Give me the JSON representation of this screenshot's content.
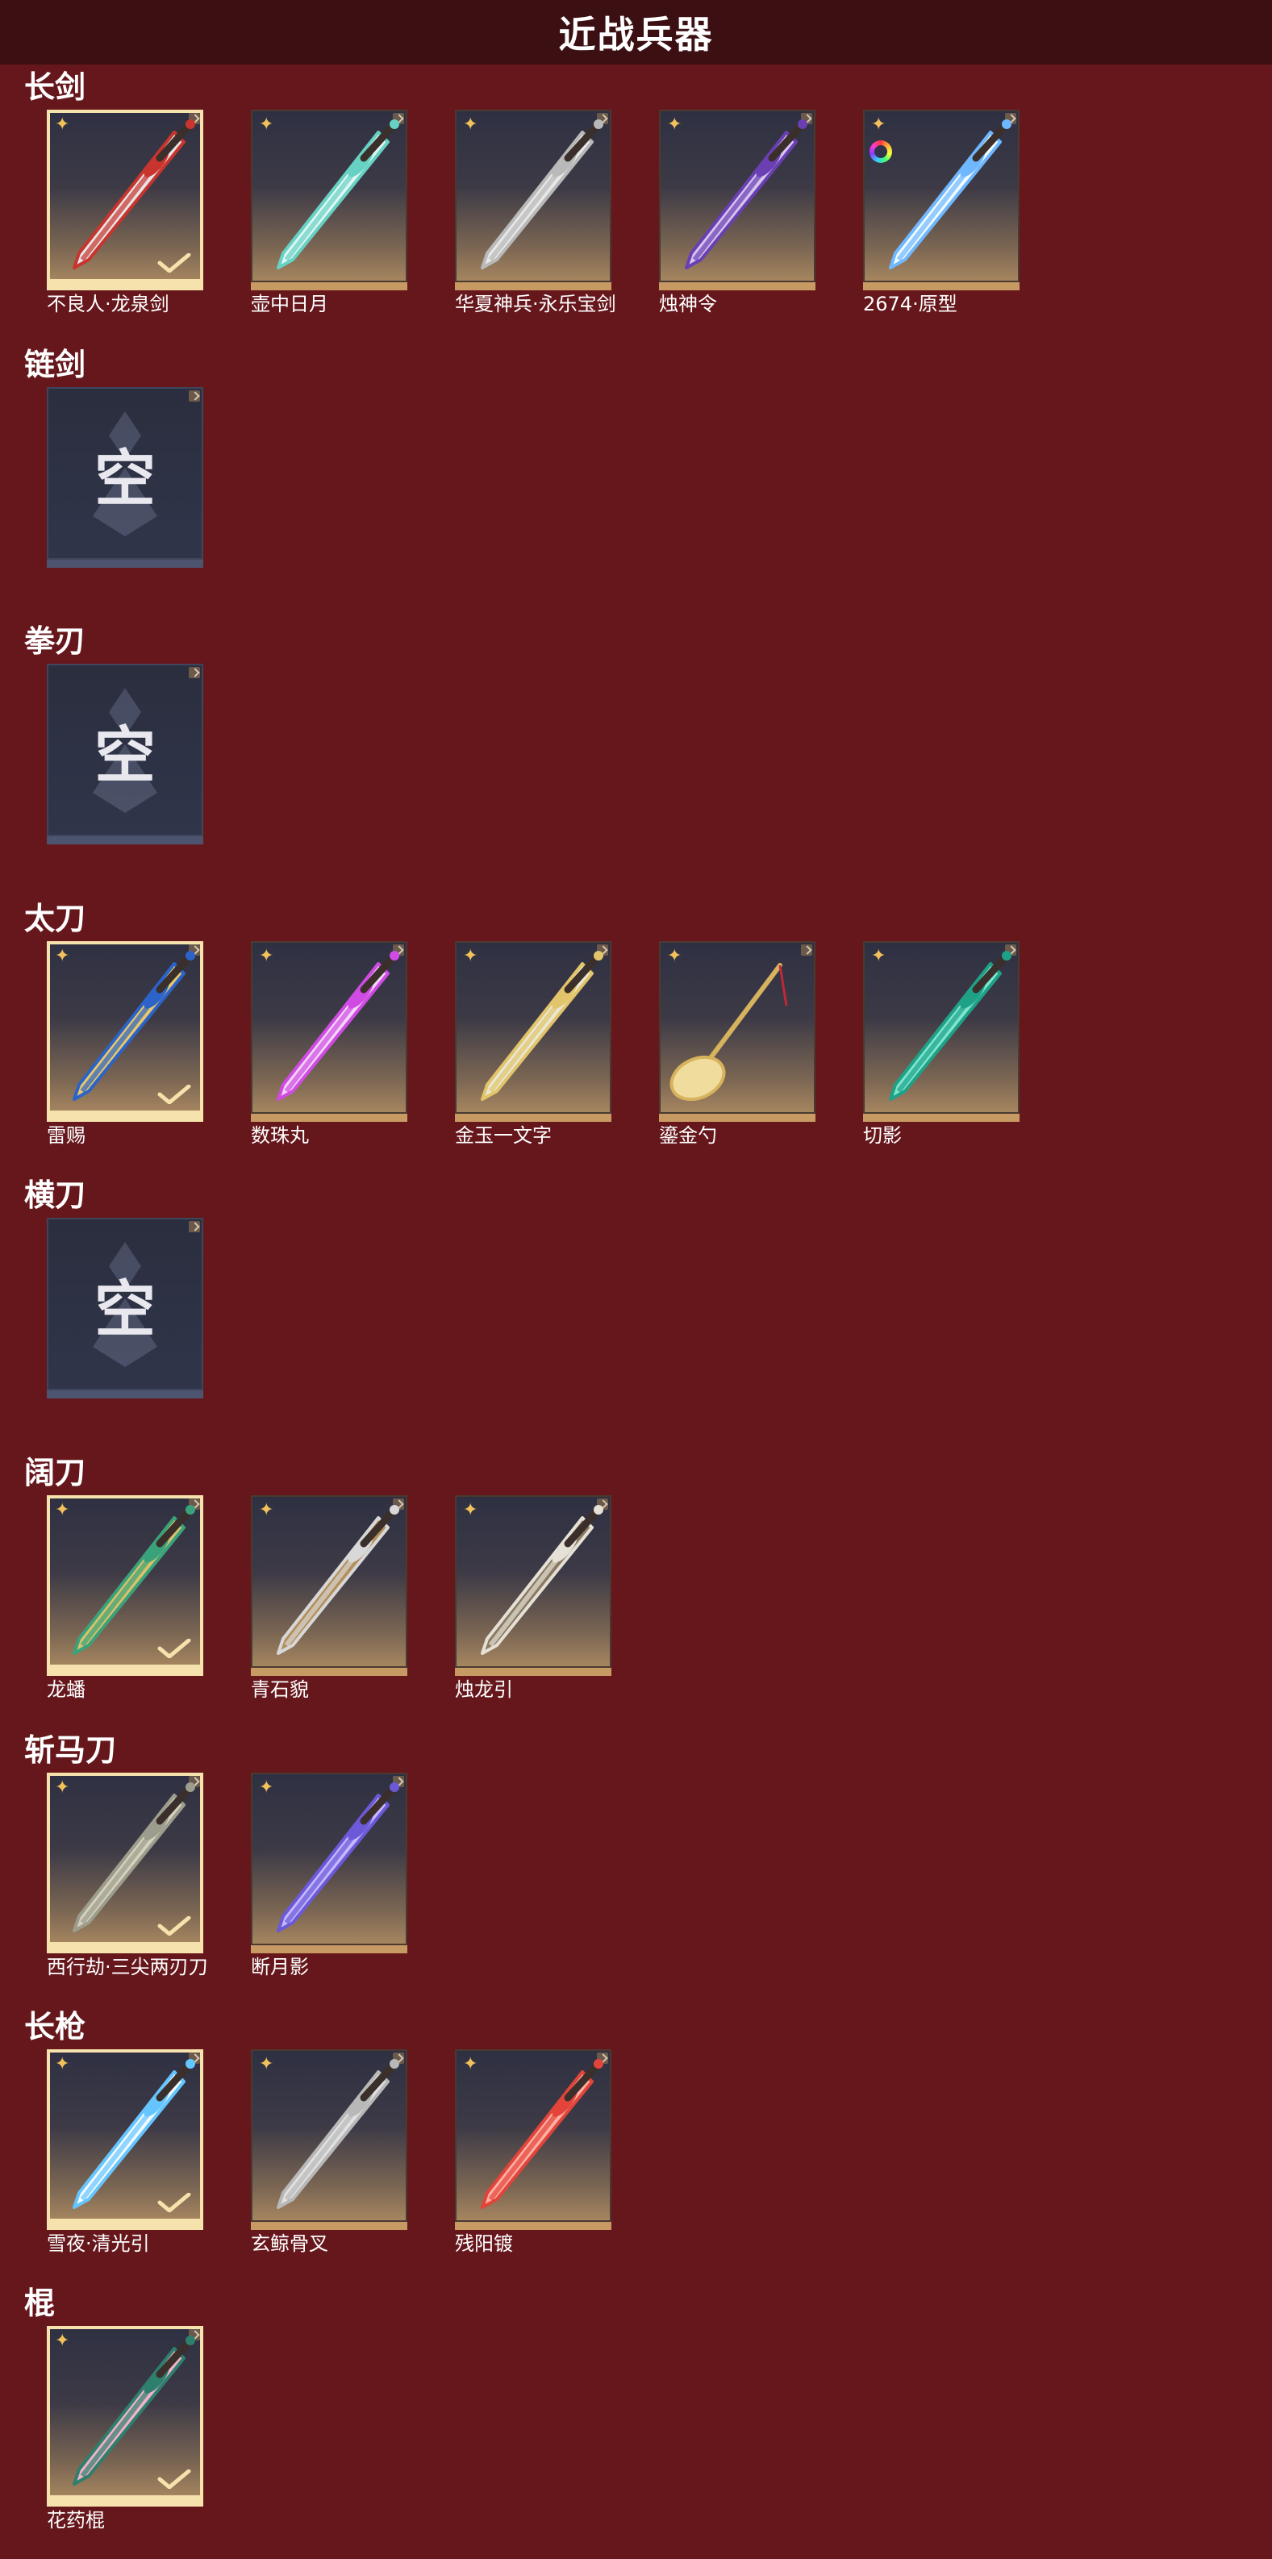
{
  "page_title": "近战兵器",
  "empty_label": "空",
  "colors": {
    "background": "#66171c",
    "topbar": "#3c1013",
    "tile_border": "#c79a63",
    "selected_border": "#f6e2ad"
  },
  "sections": [
    {
      "title": "长剑",
      "items": [
        {
          "name": "不良人·龙泉剑",
          "selected": true,
          "badge": "star",
          "icon": "sword-red-dark",
          "c1": "#c8342e",
          "c2": "#e6e6e6"
        },
        {
          "name": "壶中日月",
          "selected": false,
          "badge": "star",
          "icon": "sword-cyan",
          "c1": "#67d1c4",
          "c2": "#e0f6f2"
        },
        {
          "name": "华夏神兵·永乐宝剑",
          "selected": false,
          "badge": "star",
          "icon": "sword-silver",
          "c1": "#b9b9b9",
          "c2": "#e8e8e8"
        },
        {
          "name": "烛神令",
          "selected": false,
          "badge": "star",
          "icon": "sword-purple",
          "c1": "#6a3fb3",
          "c2": "#d6c6ee"
        },
        {
          "name": "2674·原型",
          "selected": false,
          "badge": "star-rainbow",
          "icon": "sword-laser",
          "c1": "#6fb8ff",
          "c2": "#f2fbff"
        }
      ]
    },
    {
      "title": "链剑",
      "items": [
        {
          "empty": true
        }
      ]
    },
    {
      "title": "拳刃",
      "items": [
        {
          "empty": true
        }
      ]
    },
    {
      "title": "太刀",
      "items": [
        {
          "name": "雷赐",
          "selected": true,
          "badge": "star",
          "icon": "katana-gold-blue",
          "c1": "#2b63c9",
          "c2": "#e7c86a"
        },
        {
          "name": "数珠丸",
          "selected": false,
          "badge": "star",
          "icon": "katana-magenta",
          "c1": "#d04be3",
          "c2": "#f3d7f7"
        },
        {
          "name": "金玉一文字",
          "selected": false,
          "badge": "star",
          "icon": "katana-jade",
          "c1": "#e2c46a",
          "c2": "#e8e8d6"
        },
        {
          "name": "鎏金勺",
          "selected": false,
          "badge": "star",
          "icon": "golden-spoon",
          "c1": "#d7b35d",
          "c2": "#f0dc9c"
        },
        {
          "name": "切影",
          "selected": false,
          "badge": "star",
          "icon": "katana-teal",
          "c1": "#1fa188",
          "c2": "#7ee6cf"
        }
      ]
    },
    {
      "title": "横刀",
      "items": [
        {
          "empty": true
        }
      ]
    },
    {
      "title": "阔刀",
      "items": [
        {
          "name": "龙蟠",
          "selected": true,
          "badge": "star",
          "icon": "broadblade-green",
          "c1": "#3aa27a",
          "c2": "#d9c26b"
        },
        {
          "name": "青石貌",
          "selected": false,
          "badge": "star",
          "icon": "broadblade-white",
          "c1": "#d8d8d8",
          "c2": "#b38f5a"
        },
        {
          "name": "烛龙引",
          "selected": false,
          "badge": "star",
          "icon": "broadblade-ivory",
          "c1": "#e6e1d6",
          "c2": "#8a7a62"
        }
      ]
    },
    {
      "title": "斩马刀",
      "items": [
        {
          "name": "西行劫·三尖两刃刀",
          "selected": true,
          "badge": "star",
          "icon": "polearm-trident-grey",
          "c1": "#9d9d8e",
          "c2": "#d6d1bd"
        },
        {
          "name": "断月影",
          "selected": false,
          "badge": "star",
          "icon": "zhanmadao-violet",
          "c1": "#6b59d8",
          "c2": "#c5b8ff"
        }
      ]
    },
    {
      "title": "长枪",
      "items": [
        {
          "name": "雪夜·清光引",
          "selected": true,
          "badge": "star",
          "icon": "spear-ice",
          "c1": "#65c5ff",
          "c2": "#f4fbff"
        },
        {
          "name": "玄鲸骨叉",
          "selected": false,
          "badge": "star",
          "icon": "spear-bone",
          "c1": "#b8b8b8",
          "c2": "#e1e1e1"
        },
        {
          "name": "残阳镀",
          "selected": false,
          "badge": "star",
          "icon": "spear-red",
          "c1": "#e2443a",
          "c2": "#ffb0a4"
        }
      ]
    },
    {
      "title": "棍",
      "items": [
        {
          "name": "花药棍",
          "selected": true,
          "badge": "star",
          "icon": "staff-blossom",
          "c1": "#2e7f6d",
          "c2": "#f0b3c9"
        }
      ]
    }
  ]
}
